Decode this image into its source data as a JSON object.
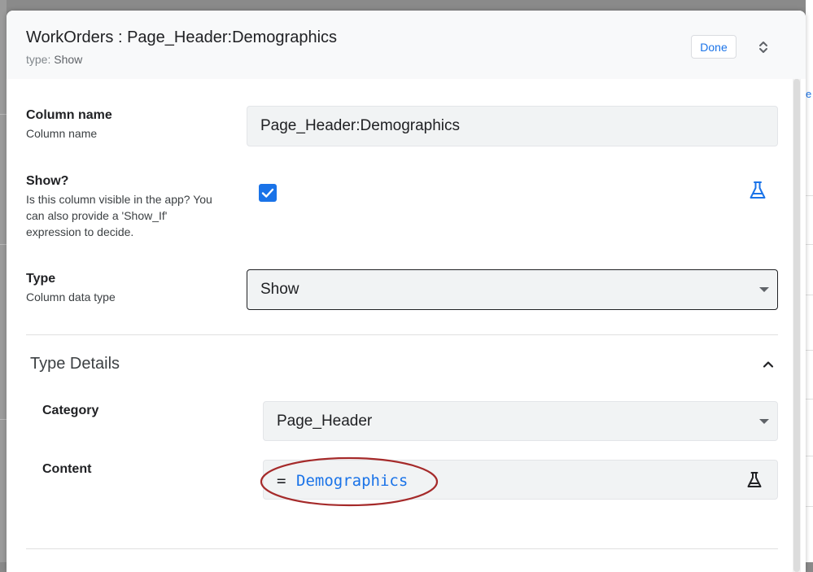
{
  "dialog": {
    "title": "WorkOrders : Page_Header:Demographics",
    "type_key": "type:",
    "type_value": "Show",
    "done_label": "Done"
  },
  "fields": {
    "column_name": {
      "label": "Column name",
      "help": "Column name",
      "value": "Page_Header:Demographics"
    },
    "show": {
      "label": "Show?",
      "help": "Is this column visible in the app? You can also provide a 'Show_If' expression to decide.",
      "checked": true
    },
    "type": {
      "label": "Type",
      "help": "Column data type",
      "value": "Show"
    }
  },
  "type_details": {
    "title": "Type Details",
    "category": {
      "label": "Category",
      "value": "Page_Header"
    },
    "content": {
      "label": "Content",
      "operator": "=",
      "value": "Demographics"
    }
  },
  "colors": {
    "accent": "#1a73e8",
    "highlight_ellipse": "#a52a2a"
  },
  "icons": {
    "expand": "unfold-more-icon",
    "checkbox": "check-icon",
    "formula": "flask-icon",
    "collapse": "chevron-up-icon",
    "dropdown": "caret-down-icon"
  }
}
